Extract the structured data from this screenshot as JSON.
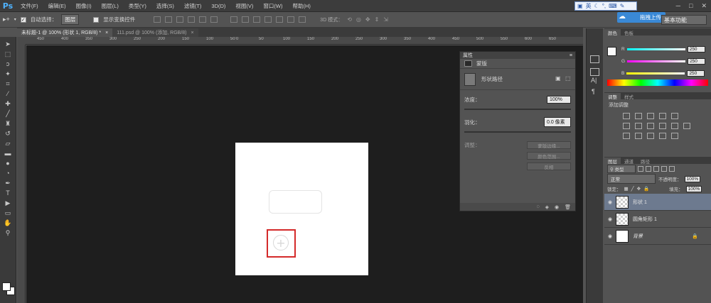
{
  "app": {
    "logo": "Ps"
  },
  "menu": [
    "文件(F)",
    "编辑(E)",
    "图像(I)",
    "图层(L)",
    "类型(Y)",
    "选择(S)",
    "滤镜(T)",
    "3D(D)",
    "视图(V)",
    "窗口(W)",
    "帮助(H)"
  ],
  "ime": {
    "mode": "英",
    "upload_label": "拖拽上传"
  },
  "options": {
    "auto_select_label": "自动选择：",
    "auto_select_value": "图层",
    "show_transform_label": "显示变换控件",
    "mode_3d_label": "3D 模式：",
    "workspace": "基本功能"
  },
  "tabs": [
    {
      "label": "未标题-1 @ 100% (形状 1, RGB/8) *",
      "close": "×"
    },
    {
      "label": "111.psd @ 100% (添加, RGB/8)",
      "close": "×"
    }
  ],
  "ruler": {
    "h_ticks": [
      "450",
      "400",
      "350",
      "300",
      "250",
      "200",
      "150",
      "100",
      "50",
      "0",
      "50",
      "100",
      "150",
      "200",
      "250",
      "300",
      "350",
      "400",
      "450",
      "500",
      "550",
      "600",
      "650"
    ]
  },
  "properties": {
    "title": "属性",
    "section": "蒙版",
    "shape_label": "形状路径",
    "density_label": "浓度：",
    "density_value": "100%",
    "feather_label": "羽化：",
    "feather_value": "0.0 像素",
    "adjust_label": "调整：",
    "edge_btn": "蒙版边缘...",
    "color_range_btn": "颜色范围...",
    "invert_btn": "反相"
  },
  "color_panel": {
    "tabs": [
      "颜色",
      "色板"
    ],
    "channels": [
      {
        "label": "R",
        "value": "250"
      },
      {
        "label": "G",
        "value": "250"
      },
      {
        "label": "B",
        "value": "250"
      }
    ]
  },
  "adjust_panel": {
    "tabs": [
      "调整",
      "样式"
    ],
    "title": "添加调整"
  },
  "layers_panel": {
    "tabs": [
      "图层",
      "通道",
      "路径"
    ],
    "kind_label": "类型",
    "blend_mode": "正常",
    "opacity_label": "不透明度：",
    "opacity_value": "100%",
    "lock_label": "锁定：",
    "fill_label": "填充：",
    "fill_value": "100%",
    "layers": [
      {
        "name": "形状 1",
        "selected": true
      },
      {
        "name": "圆角矩形 1",
        "selected": false
      },
      {
        "name": "背景",
        "selected": false
      }
    ]
  }
}
